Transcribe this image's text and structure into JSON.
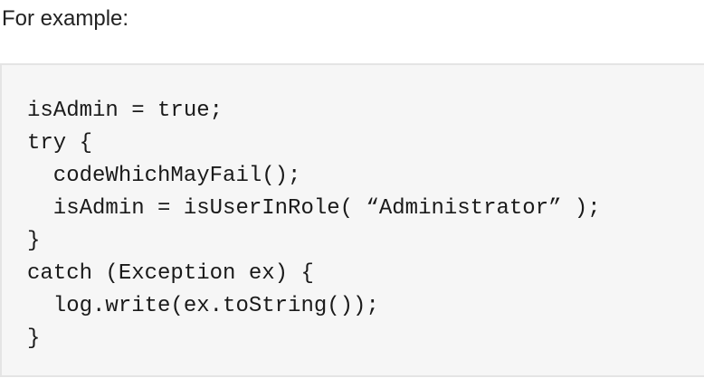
{
  "intro_text": "For example:",
  "code_lines": [
    "isAdmin = true;",
    "try {",
    "  codeWhichMayFail();",
    "  isAdmin = isUserInRole( “Administrator” );",
    "}",
    "catch (Exception ex) {",
    "  log.write(ex.toString());",
    "}"
  ]
}
